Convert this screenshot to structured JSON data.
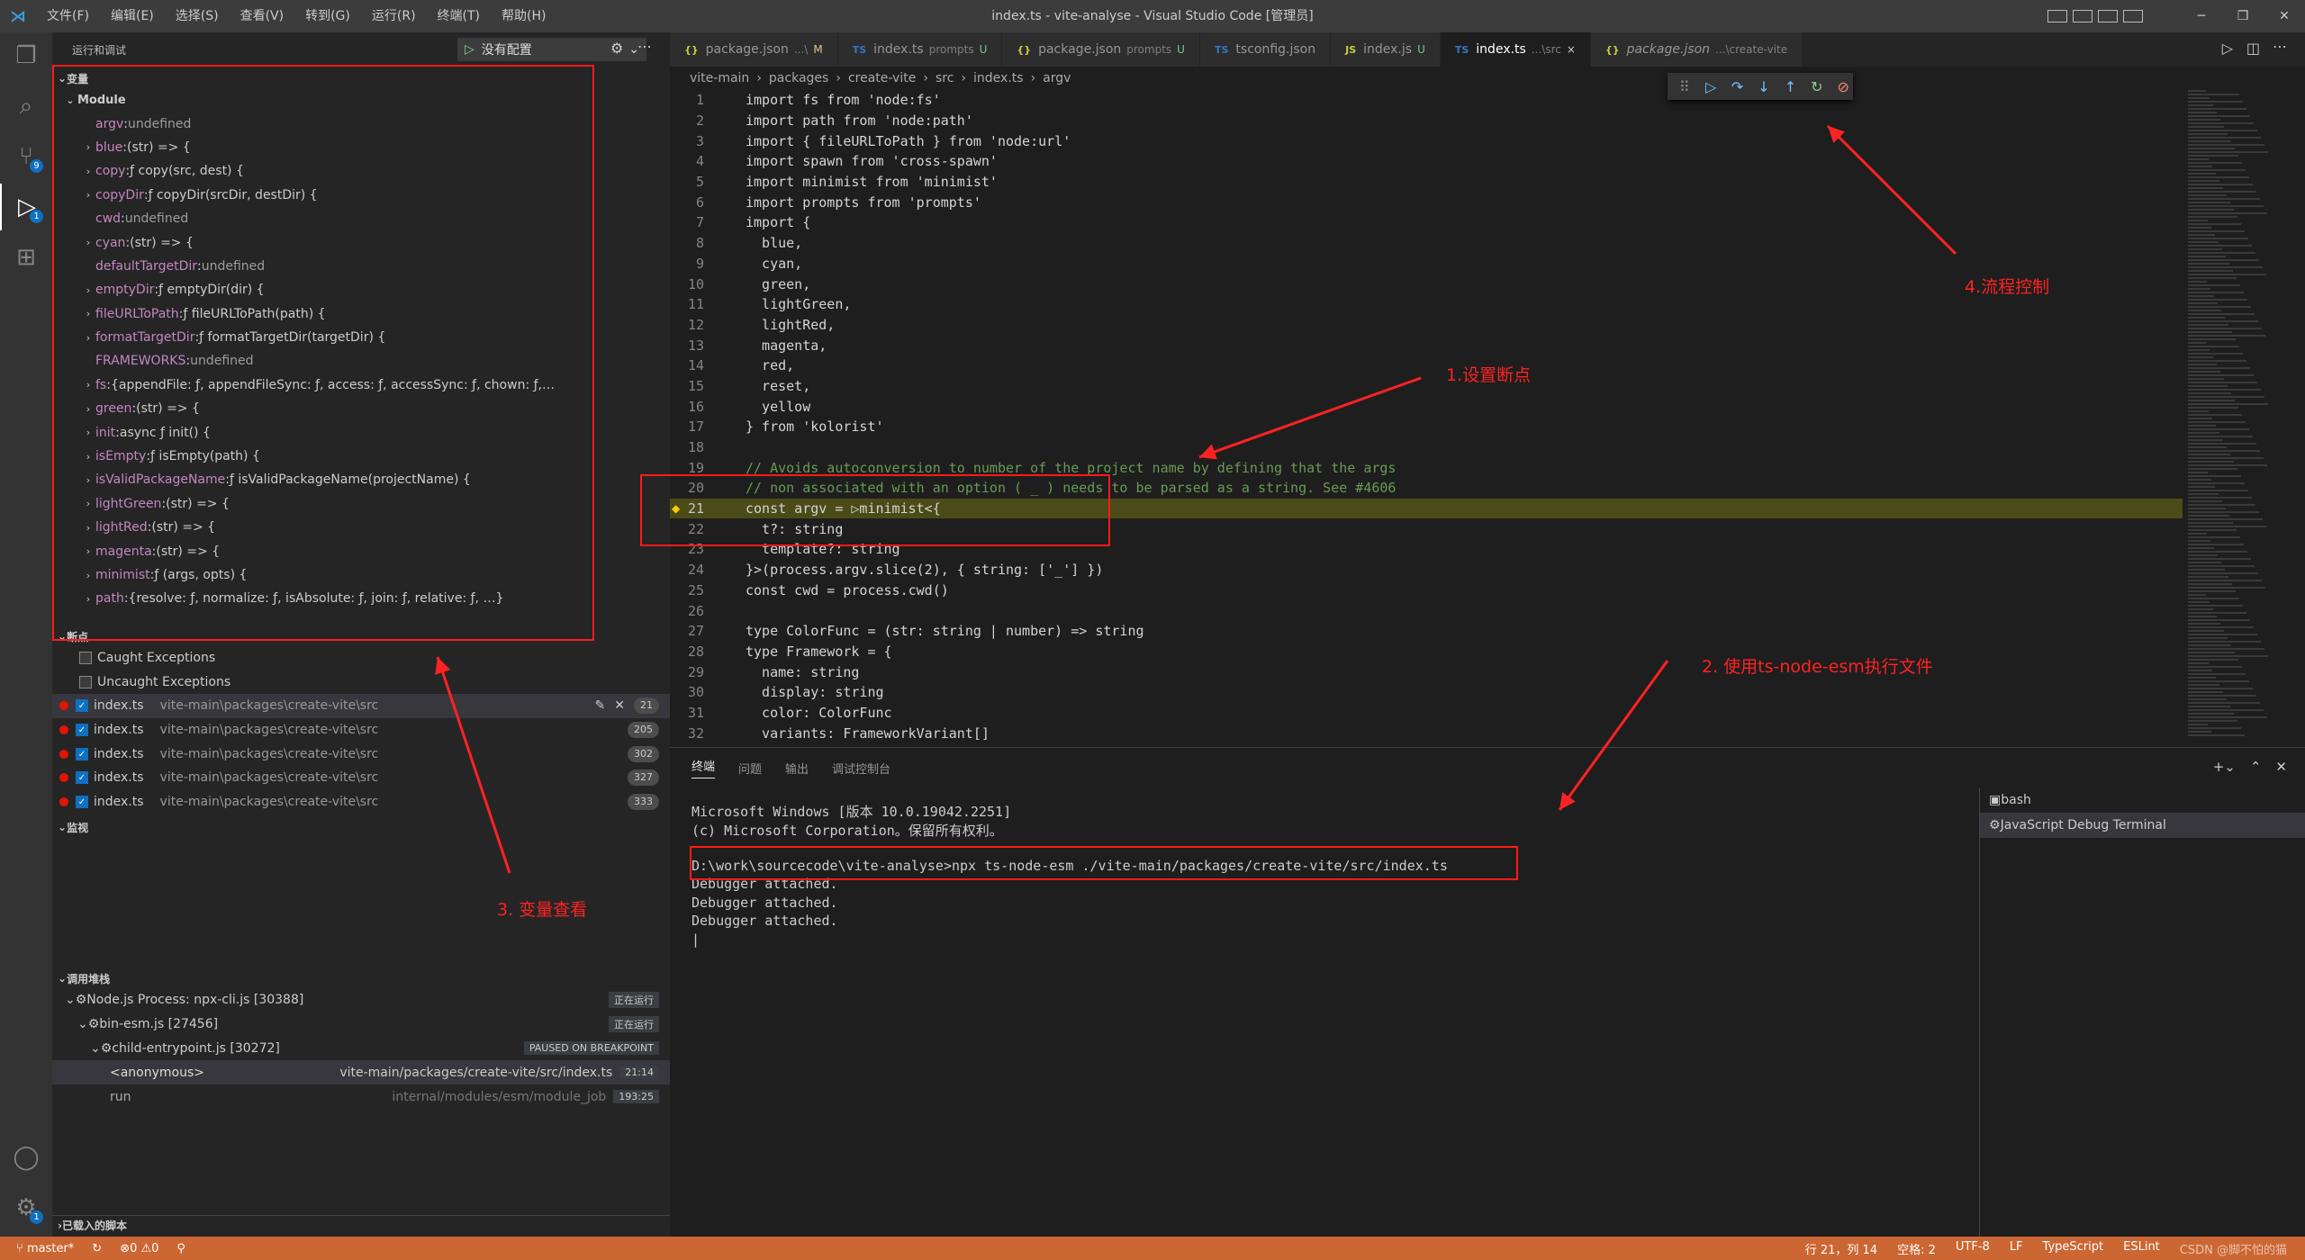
{
  "window": {
    "title": "index.ts - vite-analyse - Visual Studio Code [管理员]"
  },
  "menu": [
    "文件(F)",
    "编辑(E)",
    "选择(S)",
    "查看(V)",
    "转到(G)",
    "运行(R)",
    "终端(T)",
    "帮助(H)"
  ],
  "activity": {
    "scm_badge": "9",
    "debug_badge": "1",
    "settings_badge": "1"
  },
  "sidebar": {
    "header": "运行和调试",
    "run_config": "没有配置",
    "variables_title": "变量",
    "module_title": "Module",
    "variables": [
      {
        "name": "argv",
        "value": "undefined",
        "exp": false
      },
      {
        "name": "blue",
        "value": "(str) => {",
        "exp": true
      },
      {
        "name": "copy",
        "value": "ƒ copy(src, dest) {",
        "exp": true
      },
      {
        "name": "copyDir",
        "value": "ƒ copyDir(srcDir, destDir) {",
        "exp": true
      },
      {
        "name": "cwd",
        "value": "undefined",
        "exp": false
      },
      {
        "name": "cyan",
        "value": "(str) => {",
        "exp": true
      },
      {
        "name": "defaultTargetDir",
        "value": "undefined",
        "exp": false
      },
      {
        "name": "emptyDir",
        "value": "ƒ emptyDir(dir) {",
        "exp": true
      },
      {
        "name": "fileURLToPath",
        "value": "ƒ fileURLToPath(path) {",
        "exp": true
      },
      {
        "name": "formatTargetDir",
        "value": "ƒ formatTargetDir(targetDir) {",
        "exp": true
      },
      {
        "name": "FRAMEWORKS",
        "value": "undefined",
        "exp": false
      },
      {
        "name": "fs",
        "value": "{appendFile: ƒ, appendFileSync: ƒ, access: ƒ, accessSync: ƒ, chown: ƒ,…",
        "exp": true
      },
      {
        "name": "green",
        "value": "(str) => {",
        "exp": true
      },
      {
        "name": "init",
        "value": "async ƒ init() {",
        "exp": true
      },
      {
        "name": "isEmpty",
        "value": "ƒ isEmpty(path) {",
        "exp": true
      },
      {
        "name": "isValidPackageName",
        "value": "ƒ isValidPackageName(projectName) {",
        "exp": true
      },
      {
        "name": "lightGreen",
        "value": "(str) => {",
        "exp": true
      },
      {
        "name": "lightRed",
        "value": "(str) => {",
        "exp": true
      },
      {
        "name": "magenta",
        "value": "(str) => {",
        "exp": true
      },
      {
        "name": "minimist",
        "value": "ƒ (args, opts) {",
        "exp": true
      },
      {
        "name": "path",
        "value": "{resolve: ƒ, normalize: ƒ, isAbsolute: ƒ, join: ƒ, relative: ƒ, …}",
        "exp": true
      }
    ],
    "breakpoints_title": "断点",
    "exceptions": [
      "Caught Exceptions",
      "Uncaught Exceptions"
    ],
    "breakpoints": [
      {
        "file": "index.ts",
        "path": "vite-main\\packages\\create-vite\\src",
        "line": "21"
      },
      {
        "file": "index.ts",
        "path": "vite-main\\packages\\create-vite\\src",
        "line": "205"
      },
      {
        "file": "index.ts",
        "path": "vite-main\\packages\\create-vite\\src",
        "line": "302"
      },
      {
        "file": "index.ts",
        "path": "vite-main\\packages\\create-vite\\src",
        "line": "327"
      },
      {
        "file": "index.ts",
        "path": "vite-main\\packages\\create-vite\\src",
        "line": "333"
      }
    ],
    "watch_title": "监视",
    "callstack_title": "调用堆栈",
    "callstack": [
      {
        "label": "Node.js Process: npx-cli.js [30388]",
        "tag": "正在运行",
        "indent": 1
      },
      {
        "label": "bin-esm.js [27456]",
        "tag": "正在运行",
        "indent": 2
      },
      {
        "label": "child-entrypoint.js [30272]",
        "tag": "PAUSED ON BREAKPOINT",
        "indent": 3
      }
    ],
    "frames": [
      {
        "name": "<anonymous>",
        "src": "vite-main/packages/create-vite/src/index.ts",
        "loc": "21:14"
      },
      {
        "name": "run",
        "src": "internal/modules/esm/module_job",
        "loc": "193:25"
      }
    ],
    "loaded_scripts": "已载入的脚本"
  },
  "tabs": [
    {
      "ic": "{}",
      "name": "package.json",
      "sub": "...\\",
      "mod": "M",
      "active": false,
      "color": "#cbcb41"
    },
    {
      "ic": "TS",
      "name": "index.ts",
      "sub": "prompts",
      "mod": "U",
      "active": false,
      "color": "#3178c6"
    },
    {
      "ic": "{}",
      "name": "package.json",
      "sub": "prompts",
      "mod": "U",
      "active": false,
      "color": "#cbcb41"
    },
    {
      "ic": "TS",
      "name": "tsconfig.json",
      "sub": "",
      "mod": "",
      "active": false,
      "color": "#3178c6"
    },
    {
      "ic": "JS",
      "name": "index.js",
      "sub": "",
      "mod": "U",
      "active": false,
      "color": "#cbcb41"
    },
    {
      "ic": "TS",
      "name": "index.ts",
      "sub": "...\\src",
      "mod": "×",
      "active": true,
      "color": "#3178c6"
    },
    {
      "ic": "{}",
      "name": "package.json",
      "sub": "...\\create-vite",
      "mod": "",
      "active": false,
      "color": "#cbcb41"
    }
  ],
  "breadcrumbs": [
    "vite-main",
    "packages",
    "create-vite",
    "src",
    "index.ts",
    "argv"
  ],
  "code": [
    {
      "n": "1",
      "t": "import fs from 'node:fs'"
    },
    {
      "n": "2",
      "t": "import path from 'node:path'"
    },
    {
      "n": "3",
      "t": "import { fileURLToPath } from 'node:url'"
    },
    {
      "n": "4",
      "t": "import spawn from 'cross-spawn'"
    },
    {
      "n": "5",
      "t": "import minimist from 'minimist'"
    },
    {
      "n": "6",
      "t": "import prompts from 'prompts'"
    },
    {
      "n": "7",
      "t": "import {"
    },
    {
      "n": "8",
      "t": "  blue,"
    },
    {
      "n": "9",
      "t": "  cyan,"
    },
    {
      "n": "10",
      "t": "  green,"
    },
    {
      "n": "11",
      "t": "  lightGreen,"
    },
    {
      "n": "12",
      "t": "  lightRed,"
    },
    {
      "n": "13",
      "t": "  magenta,"
    },
    {
      "n": "14",
      "t": "  red,"
    },
    {
      "n": "15",
      "t": "  reset,"
    },
    {
      "n": "16",
      "t": "  yellow"
    },
    {
      "n": "17",
      "t": "} from 'kolorist'"
    },
    {
      "n": "18",
      "t": ""
    },
    {
      "n": "19",
      "t": "// Avoids autoconversion to number of the project name by defining that the args"
    },
    {
      "n": "20",
      "t": "// non associated with an option ( _ ) needs to be parsed as a string. See #4606"
    },
    {
      "n": "21",
      "t": "const argv = ▷minimist<{"
    },
    {
      "n": "22",
      "t": "  t?: string"
    },
    {
      "n": "23",
      "t": "  template?: string"
    },
    {
      "n": "24",
      "t": "}>(process.argv.slice(2), { string: ['_'] })"
    },
    {
      "n": "25",
      "t": "const cwd = process.cwd()"
    },
    {
      "n": "26",
      "t": ""
    },
    {
      "n": "27",
      "t": "type ColorFunc = (str: string | number) => string"
    },
    {
      "n": "28",
      "t": "type Framework = {"
    },
    {
      "n": "29",
      "t": "  name: string"
    },
    {
      "n": "30",
      "t": "  display: string"
    },
    {
      "n": "31",
      "t": "  color: ColorFunc"
    },
    {
      "n": "32",
      "t": "  variants: FrameworkVariant[]"
    }
  ],
  "panel": {
    "tabs": [
      "终端",
      "问题",
      "输出",
      "调试控制台"
    ],
    "terminal": [
      "Microsoft Windows [版本 10.0.19042.2251]",
      "(c) Microsoft Corporation。保留所有权利。",
      "",
      "D:\\work\\sourcecode\\vite-analyse>npx ts-node-esm ./vite-main/packages/create-vite/src/index.ts",
      "Debugger attached.",
      "Debugger attached.",
      "Debugger attached.",
      "|"
    ],
    "terminals": [
      "bash",
      "JavaScript Debug Terminal"
    ]
  },
  "statusbar": {
    "branch": "master*",
    "problems": "⊗0 ⚠0",
    "position": "行 21，列 14",
    "spaces": "空格: 2",
    "encoding": "UTF-8",
    "eol": "LF",
    "lang": "TypeScript",
    "eslint": "ESLint",
    "watermark": "CSDN @脚不怕的猫"
  },
  "annotations": {
    "a1": "1.设置断点",
    "a2": "2. 使用ts-node-esm执行文件",
    "a3": "3. 变量查看",
    "a4": "4.流程控制"
  },
  "colors": {
    "statusbar": "#cc6633",
    "annotation": "#ff2222",
    "accent": "#0e70c0"
  }
}
